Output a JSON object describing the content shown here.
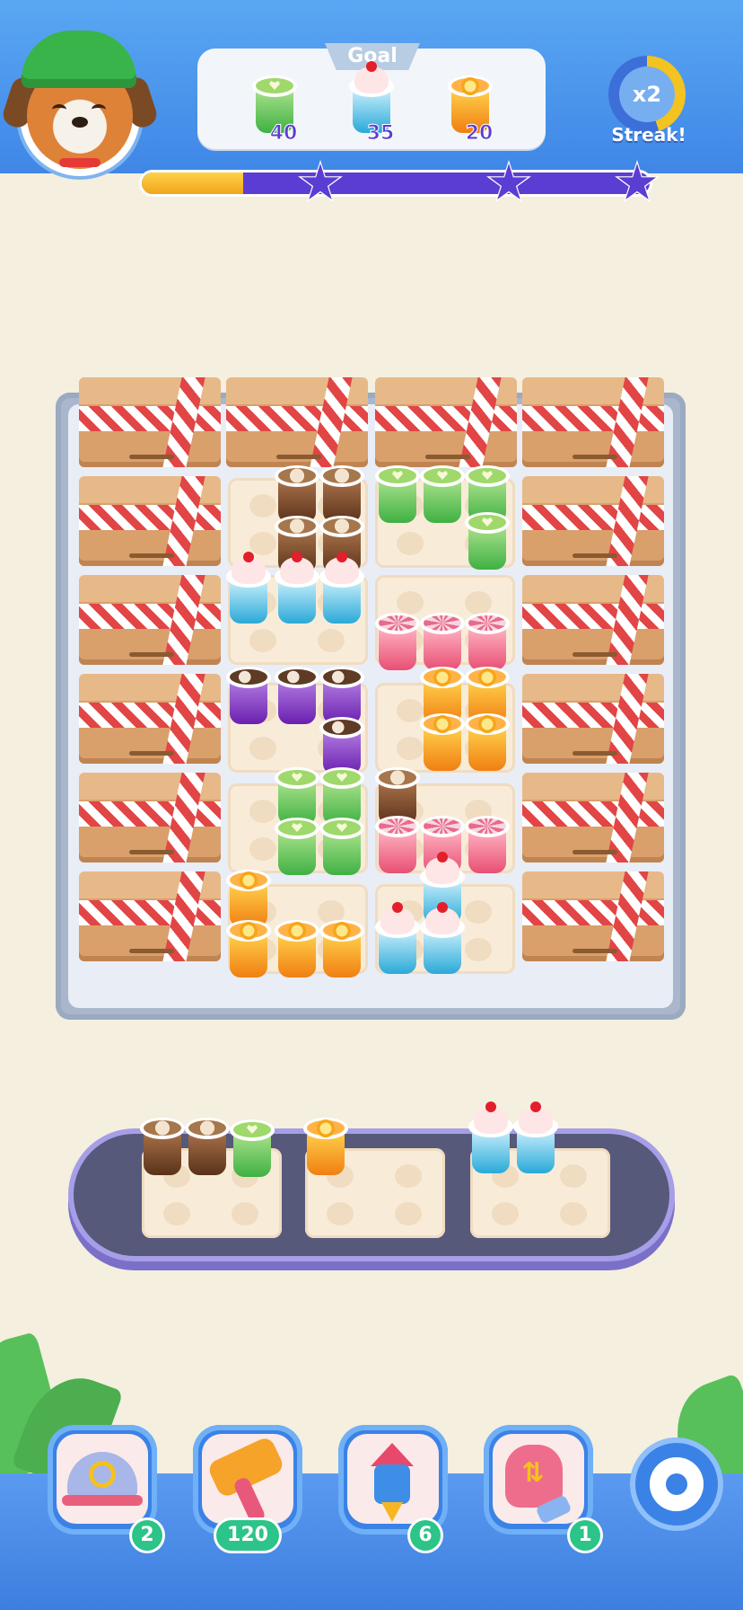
{
  "goal": {
    "title": "Goal",
    "items": [
      {
        "icon": "matcha-cup-icon",
        "count": "40"
      },
      {
        "icon": "cherry-cream-cup-icon",
        "count": "35"
      },
      {
        "icon": "orange-juice-cup-icon",
        "count": "20"
      }
    ]
  },
  "streak": {
    "multiplier": "x2",
    "label": "Streak!",
    "fill_fraction": 0.45
  },
  "progress": {
    "fraction": 0.2
  },
  "boosters": [
    {
      "icon": "shuffle-tray-icon",
      "count": "2"
    },
    {
      "icon": "hammer-icon",
      "count": "120"
    },
    {
      "icon": "rocket-icon",
      "count": "6"
    },
    {
      "icon": "swap-mitten-icon",
      "count": "1"
    }
  ],
  "colors": {
    "matcha": "#4cc64a",
    "cherry": "#2aa9d8",
    "orange": "#f29a1c",
    "pink": "#ec5c7a",
    "latte": "#7a4b2c",
    "mocha": "#7b2ec0"
  }
}
